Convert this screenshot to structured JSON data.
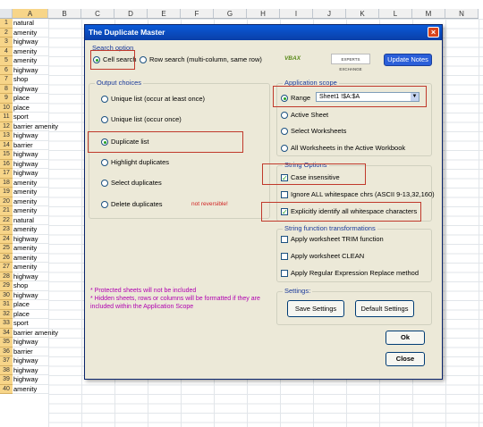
{
  "sheet": {
    "columns": [
      "A",
      "B",
      "C",
      "D",
      "E",
      "F",
      "G",
      "H",
      "I",
      "J",
      "K",
      "L",
      "M",
      "N"
    ],
    "rows": [
      {
        "n": "1",
        "v": "natural"
      },
      {
        "n": "2",
        "v": "amenity"
      },
      {
        "n": "3",
        "v": "highway"
      },
      {
        "n": "4",
        "v": "amenity"
      },
      {
        "n": "5",
        "v": "amenity"
      },
      {
        "n": "6",
        "v": "highway"
      },
      {
        "n": "7",
        "v": "shop"
      },
      {
        "n": "8",
        "v": "highway"
      },
      {
        "n": "9",
        "v": "place"
      },
      {
        "n": "10",
        "v": "place"
      },
      {
        "n": "11",
        "v": "sport"
      },
      {
        "n": "12",
        "v": "barrier amenity"
      },
      {
        "n": "13",
        "v": "highway"
      },
      {
        "n": "14",
        "v": "barrier"
      },
      {
        "n": "15",
        "v": "highway"
      },
      {
        "n": "16",
        "v": "highway"
      },
      {
        "n": "17",
        "v": "highway"
      },
      {
        "n": "18",
        "v": "amenity"
      },
      {
        "n": "19",
        "v": "amenity"
      },
      {
        "n": "20",
        "v": "amenity"
      },
      {
        "n": "21",
        "v": "amenity"
      },
      {
        "n": "22",
        "v": " natural"
      },
      {
        "n": "23",
        "v": "amenity"
      },
      {
        "n": "24",
        "v": "highway"
      },
      {
        "n": "25",
        "v": "amenity"
      },
      {
        "n": "26",
        "v": "amenity"
      },
      {
        "n": "27",
        "v": "amenity"
      },
      {
        "n": "28",
        "v": "highway"
      },
      {
        "n": "29",
        "v": "shop"
      },
      {
        "n": "30",
        "v": "highway"
      },
      {
        "n": "31",
        "v": "place"
      },
      {
        "n": "32",
        "v": "place"
      },
      {
        "n": "33",
        "v": "sport"
      },
      {
        "n": "34",
        "v": "barrier amenity"
      },
      {
        "n": "35",
        "v": "highway"
      },
      {
        "n": "36",
        "v": "barrier"
      },
      {
        "n": "37",
        "v": "highway"
      },
      {
        "n": "38",
        "v": "highway"
      },
      {
        "n": "39",
        "v": "highway"
      },
      {
        "n": "40",
        "v": "amenity"
      }
    ]
  },
  "dialog": {
    "title": "The Duplicate Master",
    "close": "×",
    "search_option": {
      "label": "Search option",
      "cell_search": "Cell search",
      "row_search": "Row search (multi-column, same row)"
    },
    "logos": {
      "vbax": "VBAX",
      "experts_exchange": "EXPERTS EXCHANGE"
    },
    "update_notes": "Update Notes",
    "output_choices": {
      "label": "Output choices",
      "unique_list": "Unique list (occur at least once)",
      "unique_list_once": "Unique list (occur once)",
      "duplicate_list": "Duplicate list",
      "highlight": "Highlight duplicates",
      "select": "Select duplicates",
      "delete": "Delete duplicates",
      "warning": "not reversible!"
    },
    "application_scope": {
      "label": "Application scope",
      "range": "Range",
      "range_value": "Sheet1 !$A:$A",
      "active_sheet": "Active Sheet",
      "select_worksheets": "Select Worksheets",
      "all_worksheets": "All Worksheets in the Active Workbook"
    },
    "string_options": {
      "label": "String Options",
      "case_insensitive": "Case insensitive",
      "ignore_whitespace": "Ignore ALL whitespace chrs (ASCII 9-13,32,160)",
      "explicit_whitespace": "Explicitly identify all whitespace characters"
    },
    "transformations": {
      "label": "String function transformations",
      "trim": "Apply worksheet TRIM function",
      "clean": "Apply worksheet CLEAN",
      "regex": "Apply Regular Expression Replace method"
    },
    "settings": {
      "label": "Settings:",
      "save": "Save Settings",
      "default": "Default  Settings"
    },
    "notes": {
      "line1": "* Protected sheets will not be included",
      "line2": "* Hidden sheets, rows or columns will be formatted if they are included within the Application Scope"
    },
    "ok": "Ok",
    "close_button": "Close"
  }
}
